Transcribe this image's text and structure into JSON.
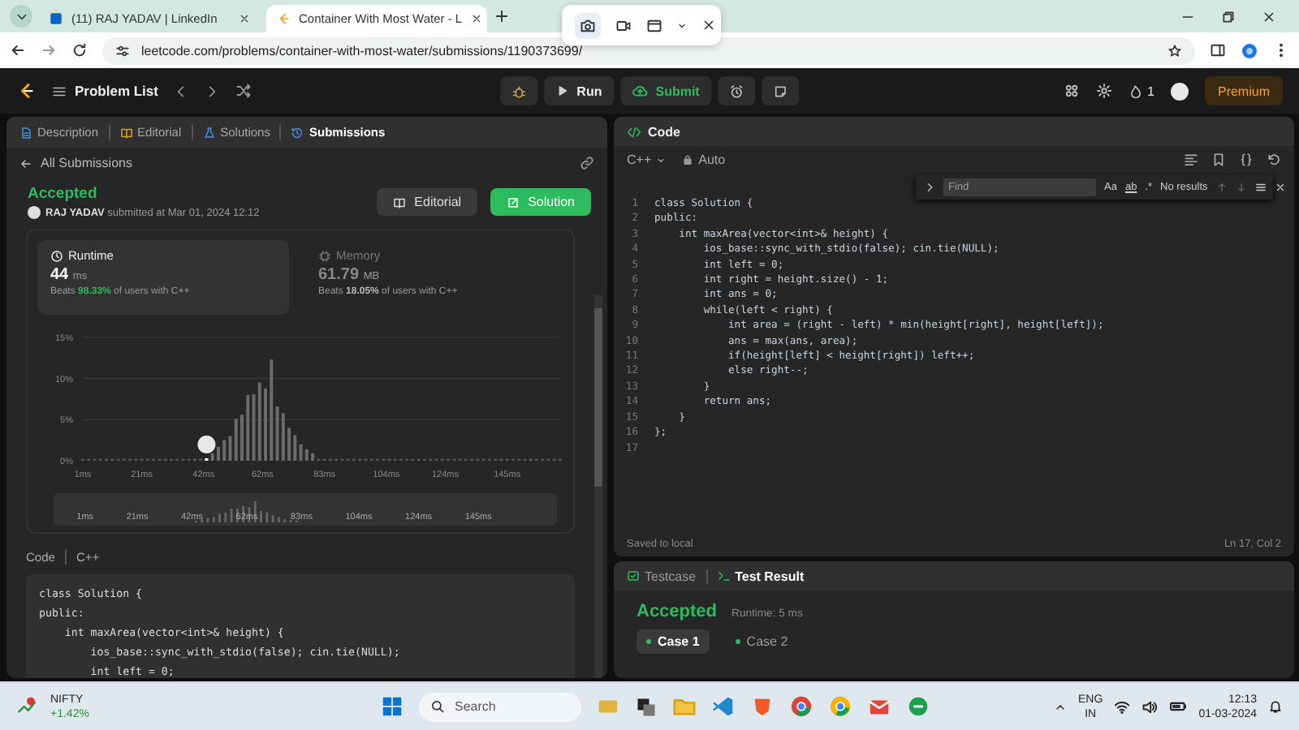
{
  "browser": {
    "tabs": [
      {
        "title": "(11) RAJ YADAV | LinkedIn",
        "selected": false
      },
      {
        "title": "Container With Most Water - L",
        "selected": true
      }
    ],
    "url": "leetcode.com/problems/container-with-most-water/submissions/1190373699/"
  },
  "nav": {
    "problem_list": "Problem List",
    "run": "Run",
    "submit": "Submit",
    "streak": "1",
    "premium": "Premium"
  },
  "left": {
    "tabs": [
      {
        "label": "Description",
        "selected": false
      },
      {
        "label": "Editorial",
        "selected": false
      },
      {
        "label": "Solutions",
        "selected": false
      },
      {
        "label": "Submissions",
        "selected": true
      }
    ],
    "back": "All Submissions",
    "status": "Accepted",
    "submitted": "**RAJ YADAV** submitted at Mar 01, 2024 12:12",
    "buttons": [
      {
        "label": "Editorial",
        "kind": "secondary"
      },
      {
        "label": "Solution",
        "kind": "primary"
      }
    ],
    "stats": [
      {
        "title": "Runtime",
        "value": "44",
        "unit": "ms",
        "beats": "Beats **98.33%** of users with C++",
        "selected": true
      },
      {
        "title": "Memory",
        "value": "61.79",
        "unit": "MB",
        "beats": "Beats **18.05%** of users with C++",
        "selected": false
      }
    ],
    "chart_data": {
      "type": "bar",
      "x": [
        1,
        3,
        5,
        7,
        9,
        11,
        13,
        15,
        17,
        19,
        21,
        23,
        25,
        27,
        29,
        31,
        33,
        35,
        37,
        39,
        41,
        43,
        45,
        47,
        49,
        51,
        53,
        55,
        57,
        59,
        61,
        63,
        65,
        67,
        69,
        71,
        73,
        75,
        77,
        79,
        81,
        83,
        85,
        87,
        89,
        91,
        93,
        95,
        97,
        99,
        101,
        103,
        105,
        107,
        109,
        111,
        113,
        115,
        117,
        119,
        121,
        123,
        125,
        127,
        129,
        131,
        133,
        135,
        137,
        139,
        141,
        143,
        145,
        147,
        149,
        151,
        153,
        155,
        157,
        159,
        161,
        163
      ],
      "values": [
        0,
        0,
        0,
        0,
        0,
        0,
        0,
        0,
        0,
        0,
        0,
        0,
        0,
        0,
        0,
        0,
        0,
        0,
        0,
        0,
        0,
        0,
        0.9,
        1.7,
        2.5,
        3,
        5.1,
        5.6,
        8,
        8.1,
        9.5,
        8.8,
        12.3,
        6.6,
        5.8,
        4,
        3.1,
        2,
        1.4,
        0.9,
        0,
        0,
        0,
        0,
        0,
        0,
        0,
        0,
        0,
        0,
        0,
        0,
        0,
        0,
        0,
        0,
        0,
        0,
        0,
        0,
        0,
        0,
        0,
        0,
        0,
        0,
        0,
        0,
        0,
        0,
        0,
        0,
        0,
        0,
        0,
        0,
        0,
        0,
        0,
        0,
        0,
        0
      ],
      "xlim": [
        1,
        163
      ],
      "ylim": [
        0,
        15
      ],
      "xticks": [
        {
          "value": 1,
          "label": "1ms"
        },
        {
          "value": 21,
          "label": "21ms"
        },
        {
          "value": 42,
          "label": "42ms"
        },
        {
          "value": 62,
          "label": "62ms"
        },
        {
          "value": 83,
          "label": "83ms"
        },
        {
          "value": 104,
          "label": "104ms"
        },
        {
          "value": 124,
          "label": "124ms"
        },
        {
          "value": 145,
          "label": "145ms"
        }
      ],
      "yticks": [
        {
          "value": 0,
          "label": "0%"
        },
        {
          "value": 5,
          "label": "5%"
        },
        {
          "value": 10,
          "label": "10%"
        },
        {
          "value": 15,
          "label": "15%"
        }
      ]
    },
    "overview_labels": [
      "1ms",
      "21ms",
      "42ms",
      "62ms",
      "83ms",
      "104ms",
      "124ms",
      "145ms"
    ],
    "code_tabs": [
      "Code",
      "C++"
    ],
    "code": [
      "class Solution {",
      "public:",
      "    int maxArea(vector<int>& height) {",
      "        ios_base::sync_with_stdio(false); cin.tie(NULL);",
      "        int left = 0;"
    ]
  },
  "editor": {
    "title": "Code",
    "language": "C++",
    "mode": "Auto",
    "find": {
      "placeholder": "Find",
      "match_case": "Aa",
      "whole_word": "ab",
      "regex": ".*",
      "result": "No results"
    },
    "lines": [
      {
        "n": "1",
        "text": "class Solution {"
      },
      {
        "n": "2",
        "text": "public:"
      },
      {
        "n": "3",
        "text": "    int maxArea(vector<int>& height) {"
      },
      {
        "n": "4",
        "text": "        ios_base::sync_with_stdio(false); cin.tie(NULL);"
      },
      {
        "n": "5",
        "text": "        int left = 0;"
      },
      {
        "n": "6",
        "text": "        int right = height.size() - 1;"
      },
      {
        "n": "7",
        "text": "        int ans = 0;"
      },
      {
        "n": "8",
        "text": "        while(left < right) {"
      },
      {
        "n": "9",
        "text": "            int area = (right - left) * min(height[right], height[left]);"
      },
      {
        "n": "10",
        "text": "            ans = max(ans, area);"
      },
      {
        "n": "11",
        "text": "            if(height[left] < height[right]) left++;"
      },
      {
        "n": "12",
        "text": "            else right--;"
      },
      {
        "n": "13",
        "text": "        }"
      },
      {
        "n": "14",
        "text": "        return ans;"
      },
      {
        "n": "15",
        "text": "    }"
      },
      {
        "n": "16",
        "text": "};"
      },
      {
        "n": "17"
      }
    ],
    "saved": "Saved to local",
    "cursor": "Ln 17, Col 2"
  },
  "result": {
    "tabs": [
      {
        "label": "Testcase",
        "selected": false
      },
      {
        "label": "Test Result",
        "selected": true
      }
    ],
    "status": "Accepted",
    "runtime": "Runtime: 5 ms",
    "cases": [
      {
        "label": "Case 1",
        "selected": true
      },
      {
        "label": "Case 2",
        "selected": false
      }
    ]
  },
  "taskbar": {
    "ticker": "NIFTY",
    "change": "+1.42%",
    "search": {
      "placeholder": "Search"
    },
    "lang": "ENG",
    "region": "IN",
    "time": "12:13",
    "date": "01-03-2024"
  }
}
